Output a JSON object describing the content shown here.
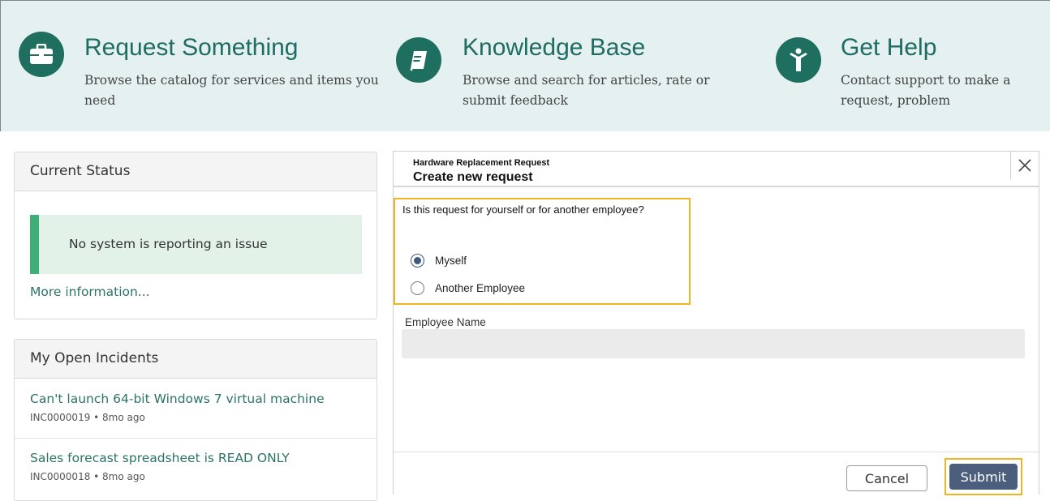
{
  "banner": {
    "tiles": [
      {
        "title": "Request Something",
        "description": "Browse the catalog for services and items you need",
        "icon": "briefcase-icon"
      },
      {
        "title": "Knowledge Base",
        "description": "Browse and search for articles, rate or submit feedback",
        "icon": "book-icon"
      },
      {
        "title": "Get Help",
        "description": "Contact support to make a request, problem",
        "icon": "person-icon"
      }
    ]
  },
  "current_status": {
    "heading": "Current Status",
    "message": "No system is reporting an issue",
    "more_link": "More information..."
  },
  "open_incidents": {
    "heading": "My Open Incidents",
    "items": [
      {
        "title": "Can't launch 64-bit Windows 7 virtual machine",
        "meta": "INC0000019 • 8mo ago"
      },
      {
        "title": "Sales forecast spreadsheet is READ ONLY",
        "meta": "INC0000018 • 8mo ago"
      }
    ]
  },
  "modal": {
    "subtitle": "Hardware Replacement Request",
    "title": "Create new request",
    "question": "Is this request for yourself or for another employee?",
    "options": [
      {
        "label": "Myself",
        "checked": true
      },
      {
        "label": "Another Employee",
        "checked": false
      }
    ],
    "field_label": "Employee Name",
    "field_value": "",
    "cancel_label": "Cancel",
    "submit_label": "Submit"
  },
  "colors": {
    "brand": "#1e6f5f",
    "banner_bg": "#e5f1f0",
    "status_ok": "#3fae77",
    "highlight": "#f2b320",
    "submit_bg": "#4b5f7d"
  }
}
